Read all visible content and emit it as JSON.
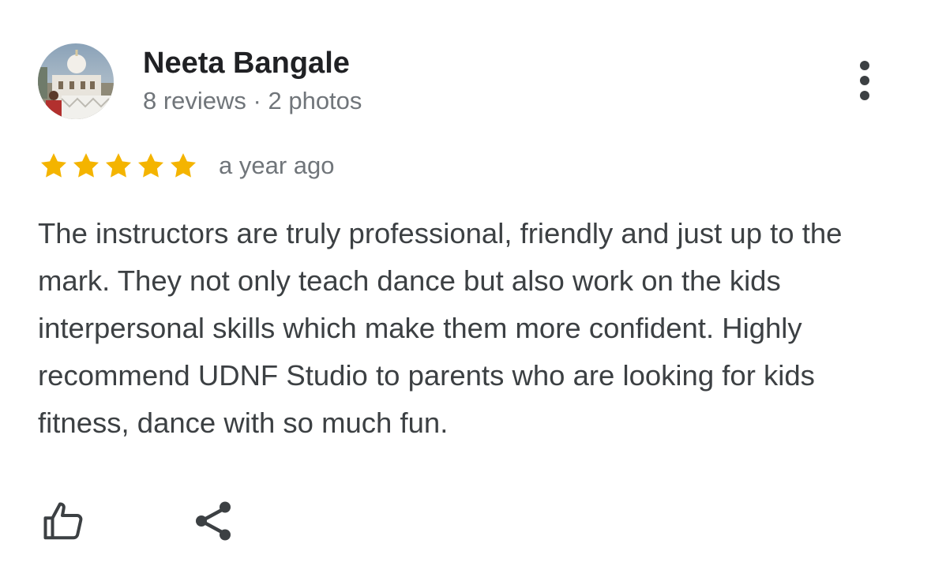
{
  "reviewer": {
    "name": "Neeta Bangale",
    "meta": "8 reviews · 2 photos",
    "avatar_icon": "profile-photo-building"
  },
  "rating": {
    "stars": 5,
    "max": 5,
    "star_color": "#f4b400",
    "date": "a year ago"
  },
  "review": {
    "text": "The instructors are truly professional, friendly and just up to the mark. They not only teach dance but also work on the kids interpersonal skills which make them more confident. Highly recommend UDNF Studio to parents who are looking for kids fitness, dance with so much fun."
  },
  "actions": {
    "like_icon": "thumbs-up-icon",
    "share_icon": "share-icon",
    "more_icon": "more-vert-icon"
  }
}
